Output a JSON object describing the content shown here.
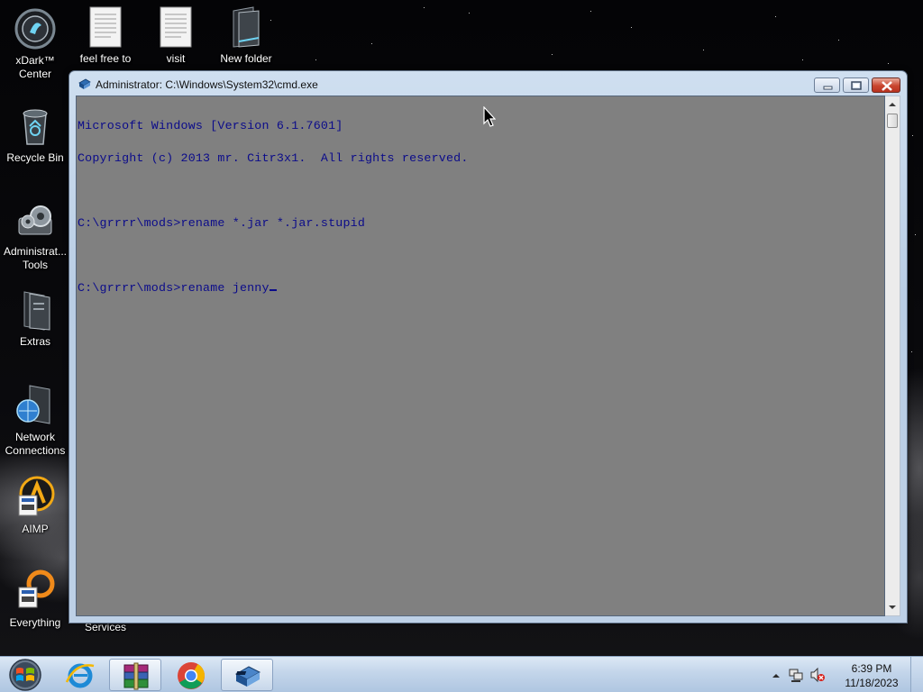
{
  "desktop": {
    "icons": [
      {
        "label": "xDark™ Center",
        "icon": "xdark-orb-icon"
      },
      {
        "label": "Recycle Bin",
        "icon": "recycle-bin-icon"
      },
      {
        "label": "Administrat... Tools",
        "icon": "admin-tools-gear-icon"
      },
      {
        "label": "Extras",
        "icon": "folder-icon"
      },
      {
        "label": "Network Connections",
        "icon": "network-globe-icon"
      },
      {
        "label": "AIMP",
        "icon": "aimp-icon"
      },
      {
        "label": "Everything",
        "icon": "everything-search-icon"
      },
      {
        "label": "feel free to",
        "icon": "text-document-icon"
      },
      {
        "label": "visit",
        "icon": "text-document-icon"
      },
      {
        "label": "New folder",
        "icon": "folder-icon"
      },
      {
        "label": "Services",
        "icon": "services-icon"
      }
    ]
  },
  "window": {
    "title": "Administrator: C:\\Windows\\System32\\cmd.exe",
    "console_lines": [
      "Microsoft Windows [Version 6.1.7601]",
      "Copyright (c) 2013 mr. Citr3x1.  All rights reserved.",
      "",
      "C:\\grrrr\\mods>rename *.jar *.jar.stupid",
      "",
      "C:\\grrrr\\mods>rename jenny"
    ],
    "text_color": "#0b0b8a",
    "background_color": "#808080"
  },
  "taskbar": {
    "items": [
      {
        "name": "internet-explorer",
        "icon": "ie-icon",
        "active": false
      },
      {
        "name": "winrar",
        "icon": "winrar-icon",
        "active": true
      },
      {
        "name": "chrome",
        "icon": "chrome-icon",
        "active": false
      },
      {
        "name": "cmd",
        "icon": "cmd-icon",
        "active": true
      }
    ],
    "clock_time": "6:39 PM",
    "clock_date": "11/18/2023"
  }
}
